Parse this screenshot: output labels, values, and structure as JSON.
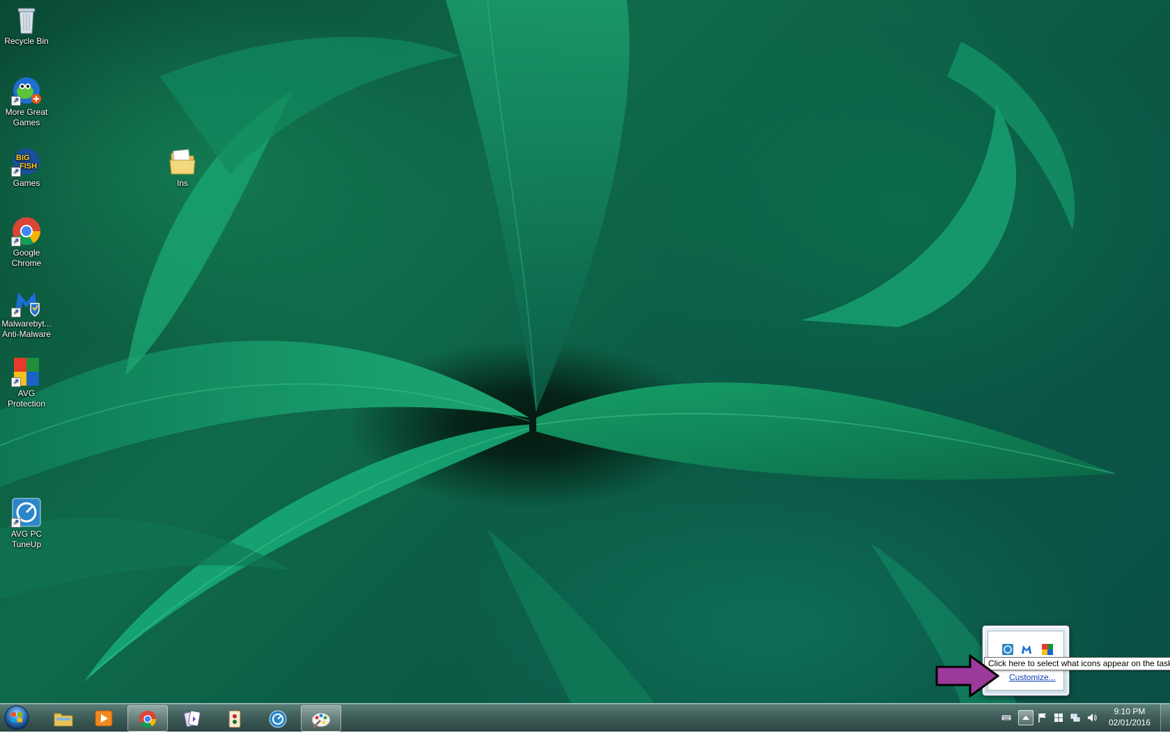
{
  "desktop": {
    "icons": [
      {
        "label": "Recycle Bin",
        "icon": "recycle-bin-icon"
      },
      {
        "label": "More Great\nGames",
        "icon": "games-frog-icon"
      },
      {
        "label": "Games",
        "icon": "big-fish-games-icon"
      },
      {
        "label": "Google\nChrome",
        "icon": "chrome-icon"
      },
      {
        "label": "Malwarebyt...\nAnti-Malware",
        "icon": "malwarebytes-icon"
      },
      {
        "label": "AVG\nProtection",
        "icon": "avg-icon"
      },
      {
        "label": "AVG PC\nTuneUp",
        "icon": "avg-tuneup-icon"
      },
      {
        "label": "Ins",
        "icon": "folder-icon"
      }
    ]
  },
  "taskbar": {
    "start": "windows-start-orb",
    "apps": [
      {
        "icon": "file-explorer-icon",
        "active": false
      },
      {
        "icon": "media-player-icon",
        "active": false
      },
      {
        "icon": "chrome-icon",
        "active": true
      },
      {
        "icon": "cards-game-icon",
        "active": false
      },
      {
        "icon": "mahjong-game-icon",
        "active": false
      },
      {
        "icon": "avg-tuneup-icon",
        "active": false
      },
      {
        "icon": "paint-icon",
        "active": true
      }
    ],
    "tray": {
      "icons": [
        "keyboard-icon",
        "show-hidden-icons-arrow",
        "action-center-flag-icon",
        "windows-icon",
        "network-icon",
        "volume-icon"
      ],
      "clock_time": "9:10 PM",
      "clock_date": "02/01/2016"
    }
  },
  "tray_popup": {
    "icons": [
      "avg-tuneup-tray-icon",
      "malwarebytes-tray-icon",
      "avg-tray-icon"
    ],
    "customize_label": "Customize..."
  },
  "tooltip": {
    "text": "Click here to select what icons appear on the taskbar."
  },
  "annotation": {
    "color": "#9b3a9b"
  }
}
